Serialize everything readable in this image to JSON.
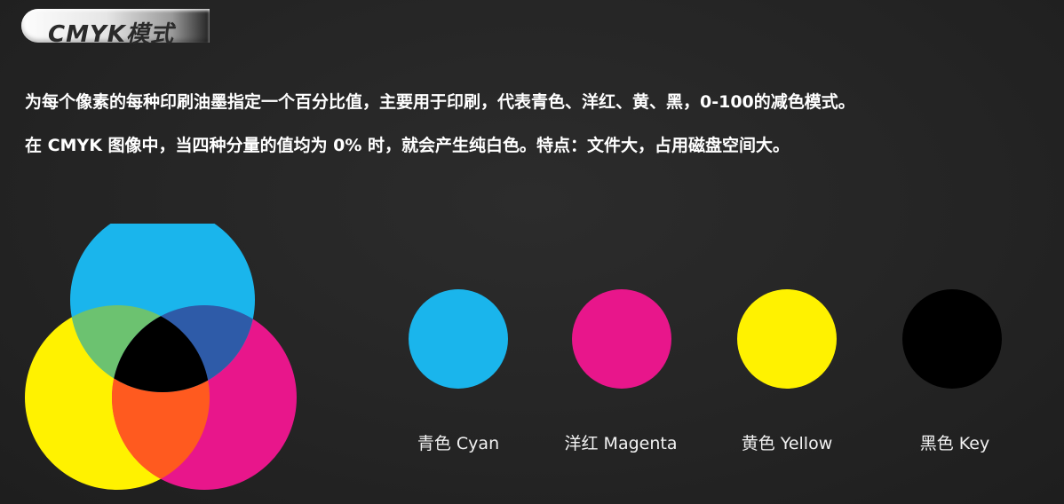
{
  "header": {
    "title": "CMYK模式"
  },
  "description": {
    "line1": "为每个像素的每种印刷油墨指定一个百分比值，主要用于印刷，代表青色、洋红、黄、黑，0-100的减色模式。",
    "line2": "在 CMYK 图像中，当四种分量的值均为 0% 时，就会产生纯白色。特点：文件大，占用磁盘空间大。"
  },
  "colors": {
    "cyan": "#1ab5ec",
    "magenta": "#e8168b",
    "yellow": "#fff200",
    "key": "#000000",
    "cyan_yellow_overlap": "#6cc270",
    "cyan_magenta_overlap": "#2e5ba8",
    "yellow_magenta_overlap": "#ff5a1f",
    "center_overlap": "#000000"
  },
  "swatches": [
    {
      "label": "青色 Cyan",
      "color": "#1ab5ec"
    },
    {
      "label": "洋红 Magenta",
      "color": "#e8168b"
    },
    {
      "label": "黄色 Yellow",
      "color": "#fff200"
    },
    {
      "label": "黑色 Key",
      "color": "#000000"
    }
  ]
}
